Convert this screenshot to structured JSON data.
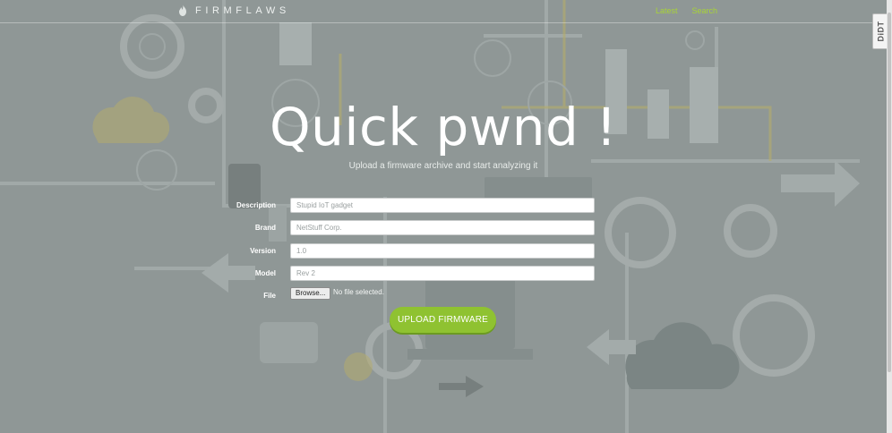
{
  "navbar": {
    "brand_text": "FIRMFLAWS",
    "links": [
      "Latest",
      "Search"
    ]
  },
  "hero": {
    "title": "Quick pwnd !",
    "subtitle": "Upload a firmware archive and start analyzing it"
  },
  "form": {
    "description": {
      "label": "Description",
      "placeholder": "Stupid IoT gadget"
    },
    "brand": {
      "label": "Brand",
      "placeholder": "NetStuff Corp."
    },
    "version": {
      "label": "Version",
      "placeholder": "1.0"
    },
    "model": {
      "label": "Model",
      "placeholder": "Rev 2"
    },
    "file": {
      "label": "File",
      "button": "Browse...",
      "status": "No file selected."
    },
    "submit": "UPLOAD FIRMWARE"
  },
  "badge_text": "DiDT",
  "colors": {
    "background": "#8f9796",
    "accent_green": "#8fc231",
    "nav_link": "#a8d436"
  }
}
